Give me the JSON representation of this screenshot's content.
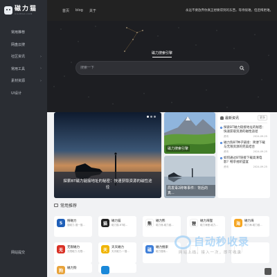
{
  "sidebar": {
    "logo_title": "磁力猫",
    "logo_sub": "CILIMAO.COM",
    "items": [
      {
        "label": "常用推荐",
        "has_sub": false
      },
      {
        "label": "网盘云搜",
        "has_sub": false
      },
      {
        "label": "社区资讯",
        "has_sub": true
      },
      {
        "label": "常用工具",
        "has_sub": true
      },
      {
        "label": "素材资源",
        "has_sub": true
      },
      {
        "label": "UI设计",
        "has_sub": false
      }
    ],
    "footer_label": "网站提交"
  },
  "topbar": {
    "links": [
      "首页",
      "blog",
      "关于"
    ],
    "notice": "永远不要放弃你真正想要得到的东西，等待很难，但后悔更难。"
  },
  "hero": {
    "tab_label": "磁力搜索引擎",
    "search_placeholder": "搜索一下"
  },
  "carousel": {
    "caption": "探索BT磁力链接地址的秘密：快速获取资源的磁性途径",
    "dots": 3,
    "active_dot": 0
  },
  "cards": [
    {
      "caption": "磁力搜索引擎"
    },
    {
      "caption": "局发毒2砖等事件：背后的真..."
    }
  ],
  "news": {
    "title": "最新资讯",
    "more": "更多",
    "items": [
      {
        "text": "探索BT磁力链接地址的秘密：快速获取资源的磁性途径",
        "tag": "资讯",
        "date": "2024-09-25"
      },
      {
        "text": "磁力狗BT种子链接：简便下载与无限资源的完美结合",
        "tag": "资讯",
        "date": "2024-09-25"
      },
      {
        "text": "如何通过BT链接下载高清电影？畅享视听盛宴",
        "tag": "资讯",
        "date": "2024-09-25"
      }
    ]
  },
  "section_title": "常用推荐",
  "tools": [
    {
      "name": "搜磁力",
      "desc": "搜磁力-搜一搜...",
      "color": "#1f5fb8",
      "glyph": "S"
    },
    {
      "name": "磁力猫",
      "desc": "磁力猫-BT磁...",
      "color": "#222222",
      "glyph": "猫"
    },
    {
      "name": "磁力熊",
      "desc": "磁力熊-磁力链...",
      "color": "#ffffff",
      "glyph": "熊"
    },
    {
      "name": "磁力海狸",
      "desc": "磁力海狸-磁力...",
      "color": "#ffffff",
      "glyph": "狸"
    },
    {
      "name": "磁力海",
      "desc": "磁力海-磁力链...",
      "color": "#f5a623",
      "glyph": "海"
    },
    {
      "name": "无限磁力",
      "desc": "无限磁力-无限...",
      "color": "#d93025",
      "glyph": "无"
    },
    {
      "name": "天天磁力",
      "desc": "天天磁力-一搜...",
      "color": "#f0b400",
      "glyph": "天"
    },
    {
      "name": "磁力搜索",
      "desc": "磁力搜索...",
      "color": "#3f7fd9",
      "glyph": "磁"
    },
    {
      "name": "",
      "desc": "",
      "color": "#ffffff",
      "glyph": ""
    },
    {
      "name": "",
      "desc": "",
      "color": "#ffffff",
      "glyph": ""
    },
    {
      "name": "磁力狗",
      "desc": "",
      "color": "#e8a33a",
      "glyph": "狗"
    },
    {
      "name": "",
      "desc": "",
      "color": "#1a88d9",
      "glyph": ""
    }
  ],
  "watermark": {
    "main": "自动秒收录",
    "sub": "网站上线，接入一次，即可收录"
  }
}
